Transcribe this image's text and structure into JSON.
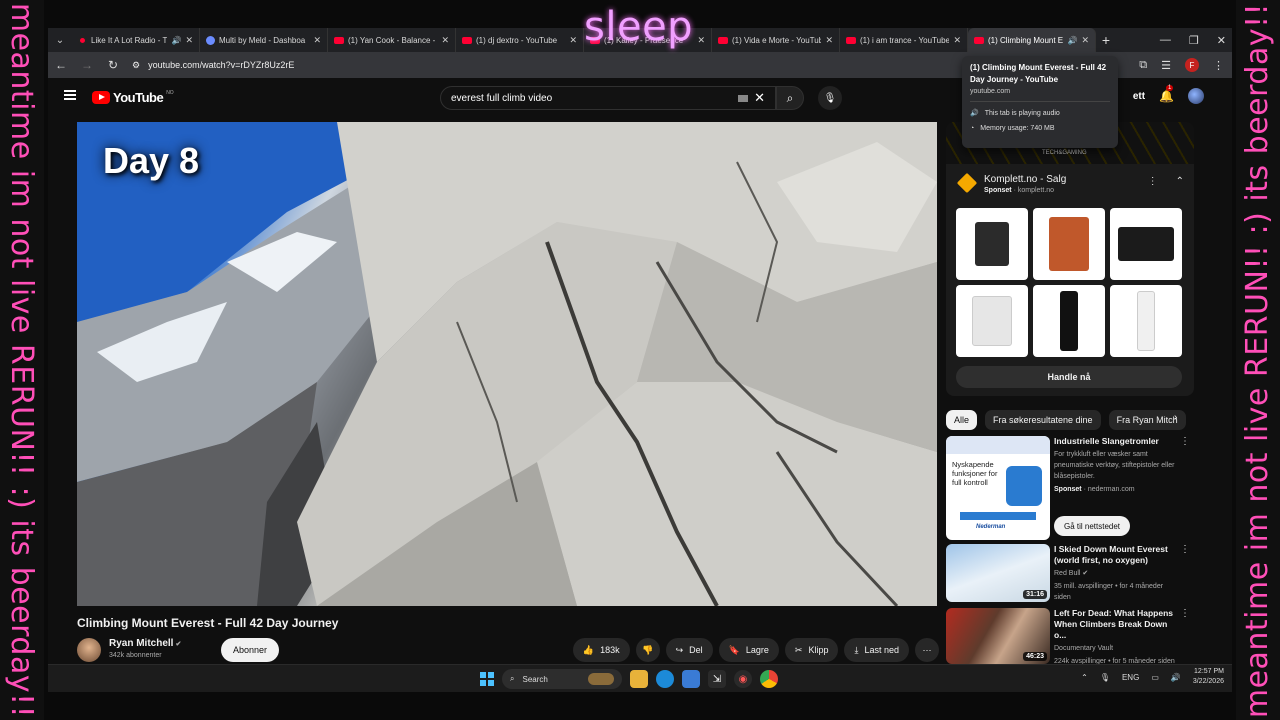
{
  "overlay": {
    "title": "sleep",
    "left_text": "meantime im not live RERUN!! :) its beerday!!",
    "right_text": "meantime im not live RERUN!! :) its beerday!!"
  },
  "tabs": [
    {
      "label": "Like It A Lot Radio - T",
      "icon": "radio-icon"
    },
    {
      "label": "Multi by Meld - Dashboa",
      "icon": "meld-icon"
    },
    {
      "label": "(1) Yan Cook - Balance - Y",
      "icon": "youtube-icon"
    },
    {
      "label": "(1) dj dextro - YouTube",
      "icon": "youtube-icon"
    },
    {
      "label": "(1) Kalley - Praesence",
      "icon": "youtube-icon"
    },
    {
      "label": "(1) Vida e Morte - YouTub",
      "icon": "youtube-icon"
    },
    {
      "label": "(1) i am trance - YouTube",
      "icon": "youtube-icon"
    },
    {
      "label": "(1) Climbing Mount E",
      "icon": "youtube-icon",
      "active": true
    }
  ],
  "address_bar": {
    "url": "youtube.com/watch?v=rDYZr8Uz2rE"
  },
  "hover_card": {
    "title": "(1) Climbing Mount Everest - Full 42 Day Journey - YouTube",
    "domain": "youtube.com",
    "audio": "This tab is playing audio",
    "memory": "Memory usage: 740 MB"
  },
  "youtube": {
    "logo": "YouTube",
    "region": "NO",
    "search_query": "everest full climb video",
    "create_label": "ett",
    "notifications": "1"
  },
  "video": {
    "overlay_text": "Day 8",
    "title": "Climbing Mount Everest - Full 42 Day Journey",
    "channel": "Ryan Mitchell",
    "subscribers": "342k abonnenter",
    "subscribe_label": "Abonner",
    "likes": "183k",
    "share": "Del",
    "save": "Lagre",
    "clip": "Klipp",
    "download": "Last ned"
  },
  "ad": {
    "advertiser": "Komplett.no - Salg",
    "sponsored": "Sponset",
    "domain": "komplett.no",
    "banner_tag": "TECH&GAMING",
    "cta": "Handle nå"
  },
  "chips": [
    "Alle",
    "Fra søkeresultatene dine",
    "Fra Ryan Mitch"
  ],
  "recommendations": [
    {
      "title": "Industrielle Slangetromler",
      "line1": "For trykkluft eller væsker samt pneumatiske verktøy, stiftepistoler eller blåsepistoler.",
      "sponsored": "Sponset",
      "domain": "nederman.com",
      "thumb_text": "Nyskapende funksjoner for full kontroll",
      "brand": "Nederman",
      "cta": "Gå til nettstedet"
    },
    {
      "title": "I Skied Down Mount Everest (world first, no oxygen)",
      "channel": "Red Bull",
      "stats": "35 mill. avspillinger • for 4 måneder siden",
      "duration": "31:16"
    },
    {
      "title": "Left For Dead: What Happens When Climbers Break Down o...",
      "channel": "Documentary Vault",
      "stats": "224k avspillinger • for 5 måneder siden",
      "duration": "46:23"
    }
  ],
  "taskbar": {
    "search": "Search",
    "lang": "ENG",
    "time": "12:57 PM",
    "date": "3/22/2026"
  }
}
